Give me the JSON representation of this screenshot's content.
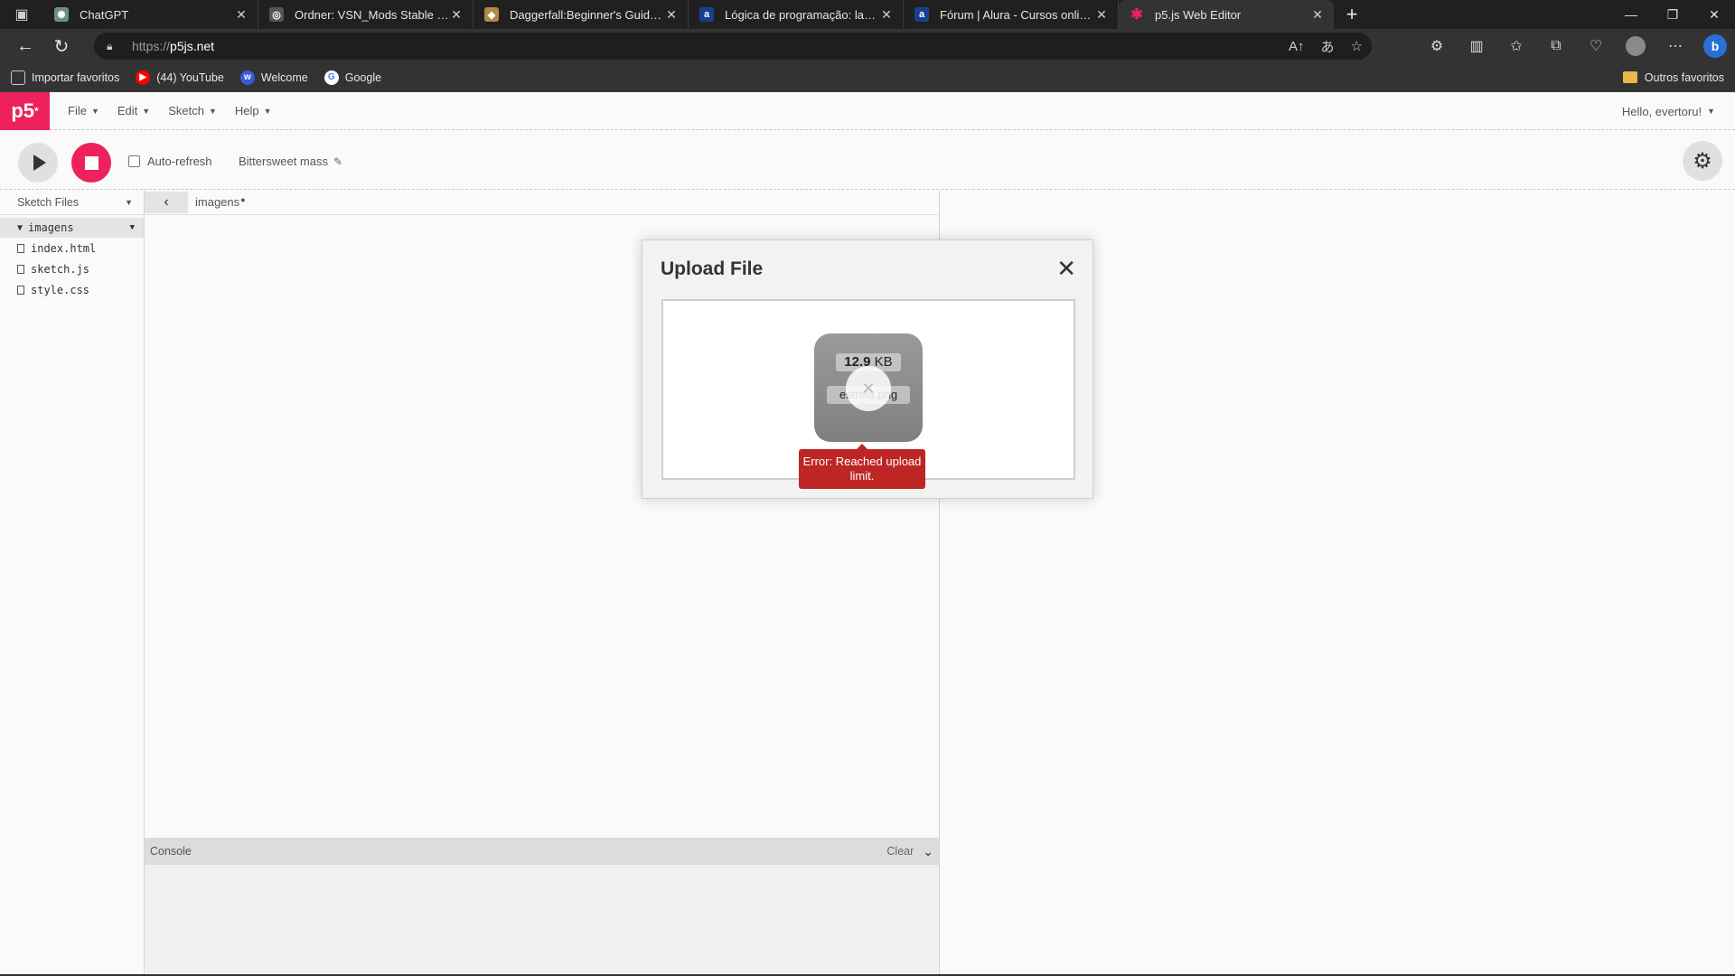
{
  "browser": {
    "tabs": [
      {
        "title": "ChatGPT",
        "icon": "chatgpt-icon",
        "color": "#6e8f86"
      },
      {
        "title": "Ordner: VSN_Mods Stable - fileh",
        "icon": "filehost-icon",
        "color": "#666666"
      },
      {
        "title": "Daggerfall:Beginner's Guide - Th",
        "icon": "daggerfall-icon",
        "color": "#b08a3e"
      },
      {
        "title": "Lógica de programação: laços e l",
        "icon": "alura-icon",
        "color": "#1a3f8f"
      },
      {
        "title": "Fórum | Alura - Cursos online de",
        "icon": "alura-icon",
        "color": "#1a3f8f"
      },
      {
        "title": "p5.js Web Editor",
        "icon": "p5-icon",
        "color": "#ed225d"
      }
    ],
    "url_prefix": "https://",
    "url_host": "p5js.net",
    "favorites": [
      {
        "label": "Importar favoritos",
        "icon": "import-icon"
      },
      {
        "label": "(44) YouTube",
        "icon": "youtube-icon",
        "color": "#ff0000"
      },
      {
        "label": "Welcome",
        "icon": "welcome-icon",
        "color": "#3a5bd9"
      },
      {
        "label": "Google",
        "icon": "google-icon",
        "color": "#4285f4"
      }
    ],
    "other_favorites": "Outros favoritos"
  },
  "editor": {
    "menu": [
      {
        "label": "File"
      },
      {
        "label": "Edit"
      },
      {
        "label": "Sketch"
      },
      {
        "label": "Help"
      }
    ],
    "greeting": "Hello, evertoru!",
    "auto_refresh_label": "Auto-refresh",
    "sketch_name": "Bittersweet mass",
    "sidebar_title": "Sketch Files",
    "folder": "imagens",
    "files": [
      "index.html",
      "sketch.js",
      "style.css"
    ],
    "open_file": "imagens",
    "console_label": "Console",
    "clear_label": "Clear",
    "accent": "#ed225d"
  },
  "modal": {
    "title": "Upload File",
    "file_size_num": "12.9",
    "file_size_unit": "KB",
    "file_name": "estrela.png",
    "error": "Error: Reached upload limit."
  }
}
